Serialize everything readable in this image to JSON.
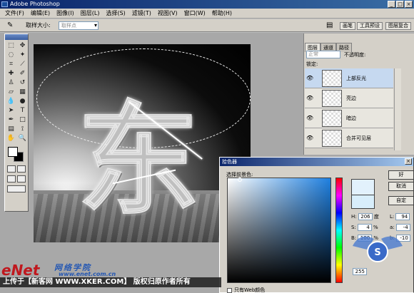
{
  "window": {
    "title": "Adobe Photoshop"
  },
  "menu": [
    "文件(F)",
    "编辑(E)",
    "图像(I)",
    "图层(L)",
    "选择(S)",
    "滤镜(T)",
    "视图(V)",
    "窗口(W)",
    "帮助(H)"
  ],
  "options": {
    "tool_icon": "eyedropper-icon",
    "sample_label": "取样大小:",
    "sample_value": "取样点",
    "btn_brushes": "画笔",
    "btn_tool_presets": "工具预设",
    "btn_layer_comps": "图层复合"
  },
  "layers_panel": {
    "tabs": [
      "图层",
      "通道",
      "路径"
    ],
    "blend_mode": "正常",
    "opacity_label": "不透明度:",
    "lock_label": "锁定:",
    "layers": [
      {
        "name": "上部反光",
        "selected": true
      },
      {
        "name": "亮边",
        "selected": false
      },
      {
        "name": "暗边",
        "selected": false
      },
      {
        "name": "合并可见层",
        "selected": false
      }
    ]
  },
  "color_picker": {
    "title": "拾色器",
    "prompt": "选择前景色:",
    "ok": "好",
    "cancel": "取消",
    "custom": "自定",
    "hsb": [
      {
        "label": "H:",
        "value": "206",
        "unit": "度"
      },
      {
        "label": "S:",
        "value": "4",
        "unit": "%"
      },
      {
        "label": "B:",
        "value": "100",
        "unit": "%"
      }
    ],
    "lab": [
      {
        "label": "L:",
        "value": "94"
      },
      {
        "label": "a:",
        "value": "-4"
      },
      {
        "label": "b:",
        "value": "-10"
      }
    ],
    "rgb_partial": "255",
    "web_only": "只有Web颜色",
    "new_color": "#e2f1fc",
    "current_color": "#d8eefb"
  },
  "canvas": {
    "glyph": "东"
  },
  "watermark": {
    "enet": "eNet",
    "site_cn": "网络学院",
    "site_url": "www.enet.com.cn",
    "caption": "上传于【新客网 WWW.XKER.COM】 版权归原作者所有"
  }
}
